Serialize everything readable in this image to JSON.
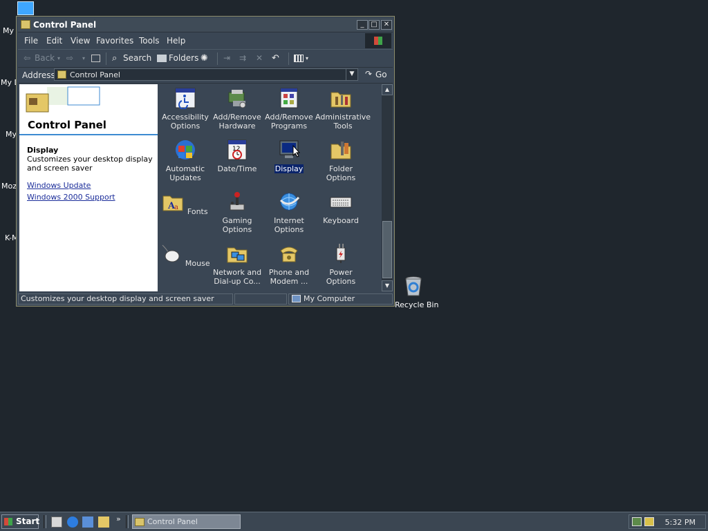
{
  "desktop": {
    "icons": [
      {
        "label": "My"
      },
      {
        "label": "My D"
      },
      {
        "label": "My"
      },
      {
        "label": "Moz"
      },
      {
        "label": "K-M"
      }
    ],
    "recycle_bin": "Recycle Bin"
  },
  "window": {
    "title": "Control Panel",
    "controls": {
      "minimize": "_",
      "maximize": "□",
      "close": "✕"
    },
    "menu": [
      "File",
      "Edit",
      "View",
      "Favorites",
      "Tools",
      "Help"
    ],
    "toolbar": {
      "back": "Back",
      "search": "Search",
      "folders": "Folders"
    },
    "address": {
      "label": "Address",
      "value": "Control Panel",
      "go": "Go"
    },
    "left_panel": {
      "title": "Control Panel",
      "selected_heading": "Display",
      "selected_desc": "Customizes your desktop display and screen saver",
      "links": [
        "Windows Update",
        "Windows 2000 Support"
      ]
    },
    "items": [
      {
        "label": "Accessibility Options",
        "icon": "accessibility-icon"
      },
      {
        "label": "Add/Remove Hardware",
        "icon": "hardware-icon"
      },
      {
        "label": "Add/Remove Programs",
        "icon": "programs-icon"
      },
      {
        "label": "Administrative Tools",
        "icon": "admin-tools-icon"
      },
      {
        "label": "Automatic Updates",
        "icon": "windows-update-icon"
      },
      {
        "label": "Date/Time",
        "icon": "date-time-icon"
      },
      {
        "label": "Display",
        "icon": "display-icon",
        "selected": true
      },
      {
        "label": "Folder Options",
        "icon": "folder-options-icon"
      },
      {
        "label": "Fonts",
        "icon": "fonts-icon"
      },
      {
        "label": "Gaming Options",
        "icon": "gaming-icon"
      },
      {
        "label": "Internet Options",
        "icon": "internet-icon"
      },
      {
        "label": "Keyboard",
        "icon": "keyboard-icon"
      },
      {
        "label": "Mouse",
        "icon": "mouse-icon"
      },
      {
        "label": "Network and Dial-up Co...",
        "icon": "network-icon"
      },
      {
        "label": "Phone and Modem ...",
        "icon": "phone-icon"
      },
      {
        "label": "Power Options",
        "icon": "power-icon"
      }
    ],
    "status": {
      "text": "Customizes your desktop display and screen saver",
      "zone": "My Computer"
    }
  },
  "taskbar": {
    "start": "Start",
    "task": "Control Panel",
    "clock": "5:32 PM"
  }
}
